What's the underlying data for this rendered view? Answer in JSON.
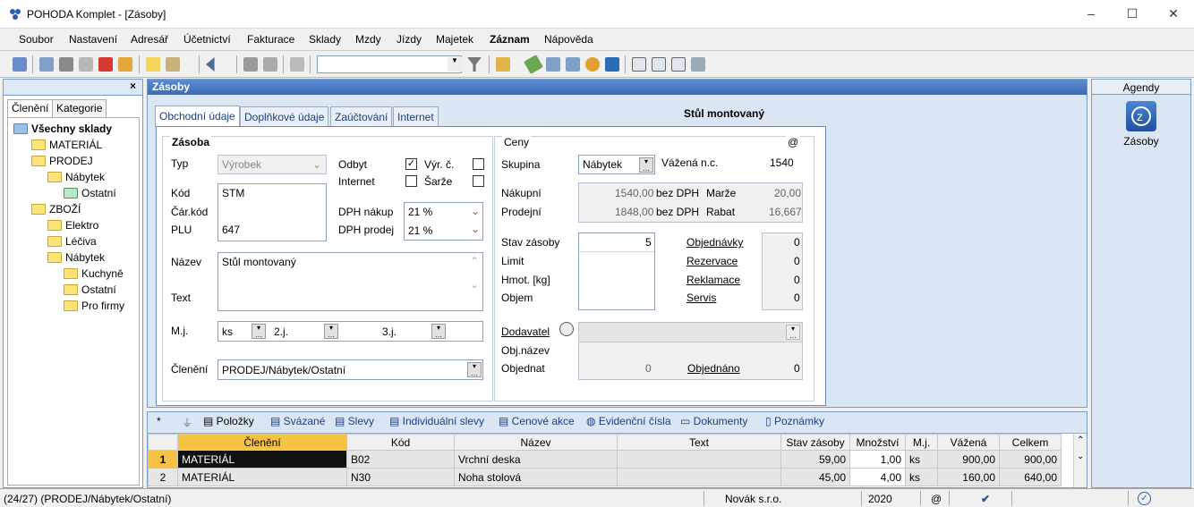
{
  "window": {
    "title": "POHODA Komplet - [Zásoby]",
    "minimize": "–",
    "maximize": "☐",
    "close": "✕"
  },
  "menu": [
    "Soubor",
    "Nastavení",
    "Adresář",
    "Účetnictví",
    "Fakturace",
    "Sklady",
    "Mzdy",
    "Jízdy",
    "Majetek",
    "Záznam",
    "Nápověda"
  ],
  "left": {
    "close": "×",
    "tabs": [
      "Členění",
      "Kategorie"
    ],
    "tree": [
      "Všechny sklady",
      "MATERIÁL",
      "PRODEJ",
      "Nábytek",
      "Ostatní",
      "ZBOŽÍ",
      "Elektro",
      "Léčiva",
      "Nábytek",
      "Kuchyně",
      "Ostatní",
      "Pro firmy"
    ]
  },
  "main": {
    "title": "Zásoby",
    "tabs": [
      "Obchodní údaje",
      "Doplňkové údaje",
      "Zaúčtování",
      "Internet"
    ],
    "record_title": "Stůl montovaný",
    "zasoba": {
      "section": "Zásoba",
      "typ_label": "Typ",
      "typ_value": "Výrobek",
      "odbyt_label": "Odbyt",
      "vyrc_label": "Výr. č.",
      "internet_label": "Internet",
      "sarze_label": "Šarže",
      "kod_label": "Kód",
      "kod_value": "STM",
      "carkod_label": "Čár.kód",
      "plu_label": "PLU",
      "plu_value": "647",
      "dph_nakup_label": "DPH nákup",
      "dph_nakup_value": "21 %",
      "dph_prodej_label": "DPH prodej",
      "dph_prodej_value": "21 %",
      "nazev_label": "Název",
      "nazev_value": "Stůl montovaný",
      "text_label": "Text",
      "mj_label": "M.j.",
      "mj_value": "ks",
      "mj2_label": "2.j.",
      "mj3_label": "3.j.",
      "cleneni_label": "Členění",
      "cleneni_value": "PRODEJ/Nábytek/Ostatní"
    },
    "ceny": {
      "section": "Ceny",
      "at": "@",
      "skupina_label": "Skupina",
      "skupina_value": "Nábytek",
      "vazena_label": "Vážená n.c.",
      "vazena_value": "1540",
      "nakupni_label": "Nákupní",
      "nakupni_value": "1540,00",
      "bezdph1": "bez DPH",
      "marze_label": "Marže",
      "marze_value": "20,00",
      "prodejni_label": "Prodejní",
      "prodejni_value": "1848,00",
      "bezdph2": "bez DPH",
      "rabat_label": "Rabat",
      "rabat_value": "16,667",
      "stav_label": "Stav zásoby",
      "stav_value": "5",
      "limit_label": "Limit",
      "hmot_label": "Hmot. [kg]",
      "objem_label": "Objem",
      "objednavky_label": "Objednávky",
      "objednavky_value": "0",
      "rezervace_label": "Rezervace",
      "rezervace_value": "0",
      "reklamace_label": "Reklamace",
      "reklamace_value": "0",
      "servis_label": "Servis",
      "servis_value": "0",
      "dodavatel_label": "Dodavatel",
      "objnazev_label": "Obj.název",
      "objednat_label": "Objednat",
      "objednat_value": "0",
      "objednano_label": "Objednáno",
      "objednano_value": "0"
    }
  },
  "right": {
    "header": "Agendy",
    "item": "Zásoby"
  },
  "bottom": {
    "star": "*",
    "tabs": [
      "Položky",
      "Svázané",
      "Slevy",
      "Individuální slevy",
      "Cenové akce",
      "Evidenční čísla",
      "Dokumenty",
      "Poznámky"
    ],
    "columns": [
      "",
      "Členění",
      "Kód",
      "Název",
      "Text",
      "Stav zásoby",
      "Množství",
      "M.j.",
      "Vážená",
      "Celkem"
    ],
    "rows": [
      [
        "1",
        "MATERIÁL",
        "B02",
        "Vrchní deska",
        "",
        "59,00",
        "1,00",
        "ks",
        "900,00",
        "900,00"
      ],
      [
        "2",
        "MATERIÁL",
        "N30",
        "Noha stolová",
        "",
        "45,00",
        "4,00",
        "ks",
        "160,00",
        "640,00"
      ]
    ]
  },
  "status": {
    "left": "(24/27) (PRODEJ/Nábytek/Ostatní)",
    "company": "Novák s.r.o.",
    "year": "2020",
    "at": "@"
  }
}
